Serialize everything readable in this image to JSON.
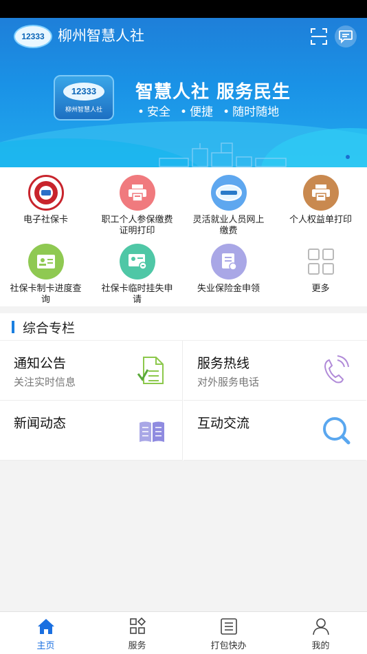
{
  "header": {
    "title": "柳州智慧人社",
    "logo_text": "12333"
  },
  "banner": {
    "logo_text": "12333",
    "logo_name": "柳州智慧人社",
    "slogan": "智慧人社 服务民生",
    "features": [
      "安全",
      "便捷",
      "随时随地"
    ]
  },
  "services": [
    {
      "label": "电子社保卡",
      "icon": "social-security-card-icon",
      "color": "#c8242c"
    },
    {
      "label": "职工个人参保缴费证明打印",
      "icon": "printer-icon",
      "color": "#f07a7e"
    },
    {
      "label": "灵活就业人员网上缴费",
      "icon": "12333-logo-icon",
      "color": "#5ea7ef"
    },
    {
      "label": "个人权益单打印",
      "icon": "printer-icon",
      "color": "#c9894f"
    },
    {
      "label": "社保卡制卡进度查询",
      "icon": "id-card-icon",
      "color": "#8fc952"
    },
    {
      "label": "社保卡临时挂失申请",
      "icon": "id-card-lock-icon",
      "color": "#4fc7a6"
    },
    {
      "label": "失业保险金申领",
      "icon": "document-edit-icon",
      "color": "#a9a7e6"
    },
    {
      "label": "更多",
      "icon": "grid-more-icon",
      "color": "#b9b9b9"
    }
  ],
  "section": {
    "title": "综合专栏"
  },
  "cards": [
    {
      "title": "通知公告",
      "subtitle": "关注实时信息",
      "icon": "document-check-icon",
      "color": "#8cc84b"
    },
    {
      "title": "服务热线",
      "subtitle": "对外服务电话",
      "icon": "phone-icon",
      "color": "#b08ad8"
    },
    {
      "title": "新闻动态",
      "subtitle": "",
      "icon": "book-icon",
      "color": "#8f8be0"
    },
    {
      "title": "互动交流",
      "subtitle": "",
      "icon": "search-icon",
      "color": "#5aa7ef"
    }
  ],
  "tabs": [
    {
      "label": "主页",
      "icon": "home-icon",
      "active": true
    },
    {
      "label": "服务",
      "icon": "apps-icon",
      "active": false
    },
    {
      "label": "打包快办",
      "icon": "list-icon",
      "active": false
    },
    {
      "label": "我的",
      "icon": "user-icon",
      "active": false
    }
  ],
  "colors": {
    "accent": "#1a6fe0",
    "banner": "#1a92e6"
  }
}
